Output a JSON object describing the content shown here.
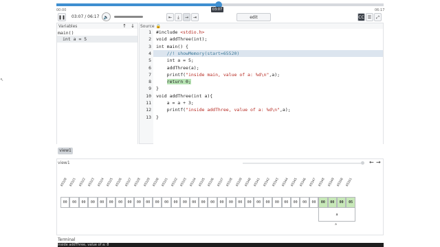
{
  "player": {
    "time_start": "00:00",
    "time_end": "06:17",
    "tooltip_time": "03:07",
    "timecode": "03:07 / 06:17",
    "progress_fraction": 0.496,
    "pause_icon": "pause-icon",
    "volume_icon": "speaker-icon",
    "step_buttons": [
      "step-back-icon",
      "step-over-icon",
      "step-into-icon",
      "step-forward-icon"
    ],
    "step_glyphs": [
      "⇤",
      "⤓",
      "→",
      "⇥"
    ],
    "edit_label": "edit",
    "right_icons": [
      "cc-icon",
      "list-icon",
      "fullscreen-icon"
    ],
    "right_glyphs": [
      "CC",
      "☰",
      "⤢"
    ]
  },
  "variables": {
    "title": "Variables",
    "frame": "main()",
    "entries": [
      "int a = 5"
    ]
  },
  "source": {
    "title": "Source",
    "lines": [
      {
        "n": "1",
        "code": "#include <stdio.h>"
      },
      {
        "n": "2",
        "code": "void addThree(int);"
      },
      {
        "n": "3",
        "code": "int main() {"
      },
      {
        "n": "4",
        "code": "    //! showMemory(start=65520)"
      },
      {
        "n": "5",
        "code": "    int a = 5;"
      },
      {
        "n": "6",
        "code": "    addThree(a);"
      },
      {
        "n": "7",
        "code": "    printf(\"inside main, value of a: %d\\n\",a);"
      },
      {
        "n": "8",
        "code": "    return 0;"
      },
      {
        "n": "9",
        "code": "}"
      },
      {
        "n": "10",
        "code": "void addThree(int a){"
      },
      {
        "n": "11",
        "code": "    a = a + 3;"
      },
      {
        "n": "12",
        "code": "    printf(\"inside addThree, value of a: %d\\n\",a);"
      },
      {
        "n": "13",
        "code": "}"
      }
    ]
  },
  "view": {
    "tab_label": "view1",
    "panel_title": "view1",
    "addresses": [
      "65520",
      "65521",
      "65522",
      "65523",
      "65524",
      "65525",
      "65526",
      "65527",
      "65528",
      "65529",
      "65530",
      "65531",
      "65532",
      "65533",
      "65534",
      "65535",
      "65536",
      "65537",
      "65538",
      "65539",
      "65540",
      "65541",
      "65542",
      "65543",
      "65544",
      "65545",
      "65546",
      "65547",
      "65548",
      "65549",
      "65550",
      "65551"
    ],
    "bytes": [
      "00",
      "00",
      "00",
      "00",
      "00",
      "00",
      "00",
      "00",
      "00",
      "00",
      "00",
      "00",
      "00",
      "00",
      "00",
      "00",
      "00",
      "00",
      "00",
      "00",
      "00",
      "00",
      "00",
      "00",
      "00",
      "00",
      "00",
      "00",
      "00",
      "00",
      "00",
      "05"
    ],
    "highlight_start": 28,
    "var_name": "a",
    "var_sub": "a"
  },
  "terminal": {
    "title": "Terminal",
    "text": "inside addThree, value of a: 8"
  }
}
